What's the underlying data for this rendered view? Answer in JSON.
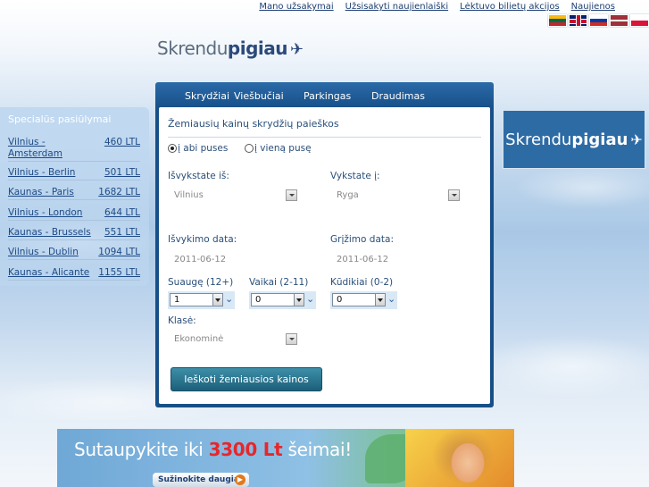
{
  "top_links": [
    "Mano užsakymai",
    "Užsisakyti naujienlaiški",
    "Lėktuvo bilietų akcijos",
    "Naujienos"
  ],
  "languages": [
    "lt",
    "en",
    "ru",
    "lv",
    "pl"
  ],
  "logo": {
    "part1": "Skrendu",
    "part2": "pigiau",
    "icon": "plane-icon"
  },
  "offers": {
    "title": "Specialūs pasiūlymai",
    "items": [
      {
        "route": "Vilnius - Amsterdam",
        "price": "460 LTL"
      },
      {
        "route": "Vilnius - Berlin",
        "price": "501 LTL"
      },
      {
        "route": "Kaunas - Paris",
        "price": "1682 LTL"
      },
      {
        "route": "Vilnius - London",
        "price": "644 LTL"
      },
      {
        "route": "Kaunas - Brussels",
        "price": "551 LTL"
      },
      {
        "route": "Vilnius - Dublin",
        "price": "1094 LTL"
      },
      {
        "route": "Kaunas - Alicante",
        "price": "1155 LTL"
      }
    ]
  },
  "tabs": [
    "Skrydžiai",
    "Viešbučiai",
    "Parkingas",
    "Draudimas"
  ],
  "form": {
    "title": "Žemiausių kainų skrydžių paieškos",
    "trip_both": "į abi puses",
    "trip_one": "į vieną pusę",
    "from_label": "Išvykstate iš:",
    "from_value": "Vilnius",
    "to_label": "Vykstate į:",
    "to_value": "Ryga",
    "depart_label": "Išvykimo data:",
    "depart_value": "2011-06-12",
    "return_label": "Grįžimo data:",
    "return_value": "2011-06-12",
    "adults_label": "Suaugę (12+)",
    "adults_value": "1",
    "children_label": "Vaikai (2-11)",
    "children_value": "0",
    "infants_label": "Kūdikiai (0-2)",
    "infants_value": "0",
    "class_label": "Klasė:",
    "class_value": "Ekonominė",
    "search_button": "Ieškoti žemiausios kainos"
  },
  "side_ad": {
    "part1": "Skrendu",
    "part2": "pigiau"
  },
  "banner": {
    "text1": "Sutaupykite iki",
    "amount": "3300 Lt",
    "text2": "šeimai!",
    "button": "Sužinokite daugiau"
  }
}
